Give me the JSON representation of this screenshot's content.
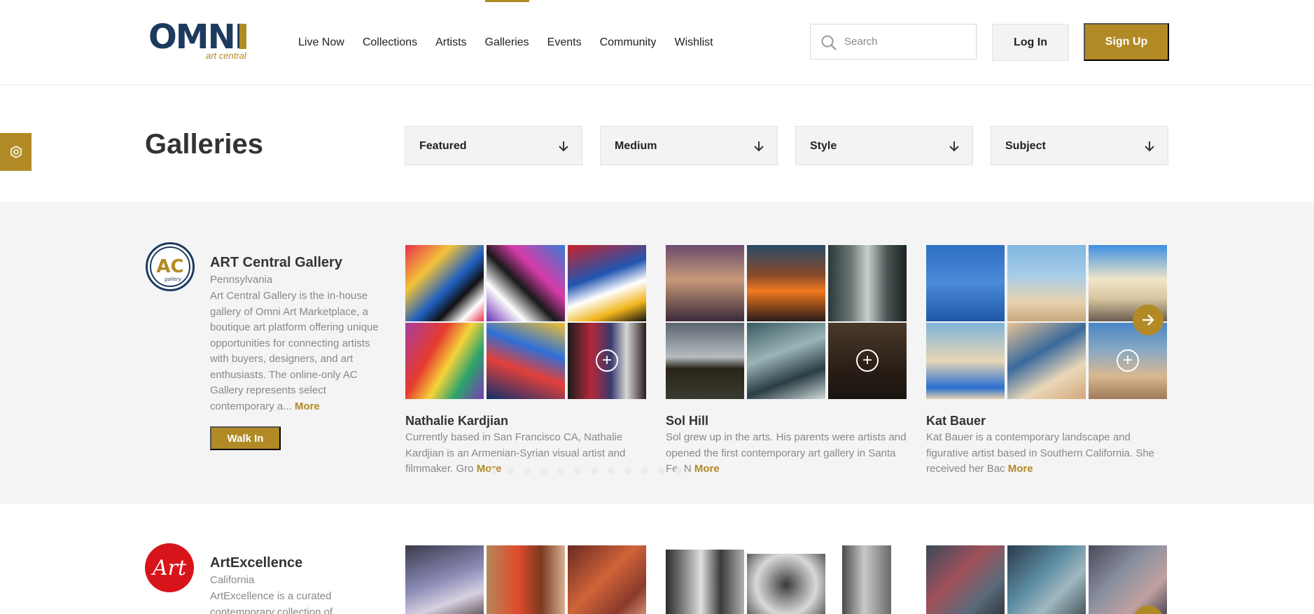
{
  "header": {
    "logo_text": "OMNI",
    "logo_sub": "art central",
    "nav": [
      "Live Now",
      "Collections",
      "Artists",
      "Galleries",
      "Events",
      "Community",
      "Wishlist"
    ],
    "active_nav": "Galleries",
    "search_placeholder": "Search",
    "login_label": "Log In",
    "signup_label": "Sign Up"
  },
  "page": {
    "title": "Galleries",
    "filters": [
      "Featured",
      "Medium",
      "Style",
      "Subject"
    ]
  },
  "galleries": [
    {
      "avatar_text": "AC",
      "avatar_sub": "gallery",
      "name": "ART Central Gallery",
      "location": "Pennsylvania",
      "description": "Art Central Gallery is the in-house gallery of Omni Art Marketplace, a boutique art platform offering unique opportunities for connecting artists with buyers, designers, and art enthusiasts. The online-only AC Gallery represents select contemporary a...",
      "more_label": "More",
      "walk_in_label": "Walk In",
      "artists": [
        {
          "name": "Nathalie Kardjian",
          "bio": "Currently based in San Francisco CA, Nathalie Kardjian is an Armenian-Syrian visual artist and filmmaker. Gro",
          "more_label": "More"
        },
        {
          "name": "Sol Hill",
          "bio": "Sol grew up in the arts. His parents were artists and opened the first contemporary art gallery in Santa Fe, N",
          "more_label": "More"
        },
        {
          "name": "Kat Bauer",
          "bio": "Kat Bauer is a contemporary landscape and figurative artist based in Southern California. She received her Bac",
          "more_label": "More"
        }
      ]
    },
    {
      "avatar_text": "Art",
      "name": "ArtExcellence",
      "location": "California",
      "description": "ArtExcellence is a curated contemporary collection of"
    }
  ],
  "colors": {
    "accent": "#b28a25",
    "navy": "#1d3a5f",
    "section_bg": "#f4f4f4",
    "artexcellence_red": "#d8141b"
  }
}
